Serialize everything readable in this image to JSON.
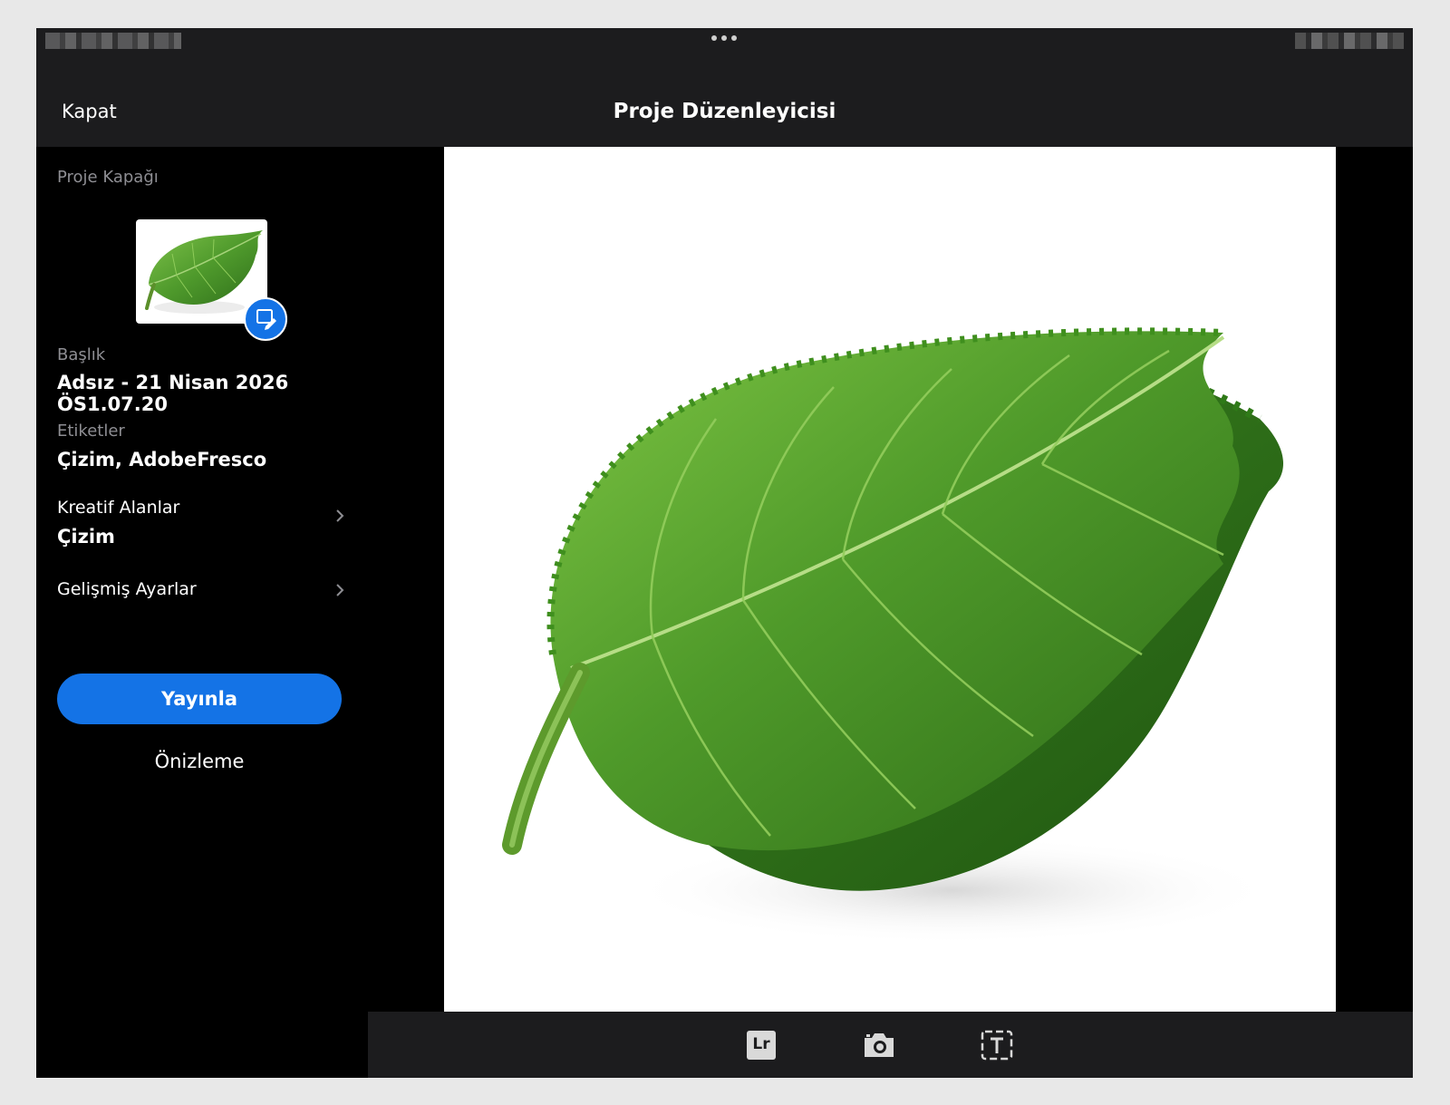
{
  "header": {
    "close_label": "Kapat",
    "title": "Proje Düzenleyicisi"
  },
  "sidebar": {
    "cover_label": "Proje Kapağı",
    "title_label": "Başlık",
    "title_value": "Adsız - 21 Nisan 2026 ÖS1.07.20",
    "tags_label": "Etiketler",
    "tags_value": "Çizim, AdobeFresco",
    "creative_fields_label": "Kreatif Alanlar",
    "creative_fields_value": "Çizim",
    "advanced_settings_label": "Gelişmiş Ayarlar",
    "publish_label": "Yayınla",
    "preview_label": "Önizleme"
  },
  "toolbar": {
    "lightroom_text": "Lr",
    "icons": [
      "lightroom-icon",
      "camera-icon",
      "text-icon"
    ]
  },
  "colors": {
    "accent": "#1473e6",
    "background": "#000000",
    "panel": "#1c1c1e",
    "muted_text": "#8e8e93",
    "leaf_green": "#4c9a2a"
  }
}
